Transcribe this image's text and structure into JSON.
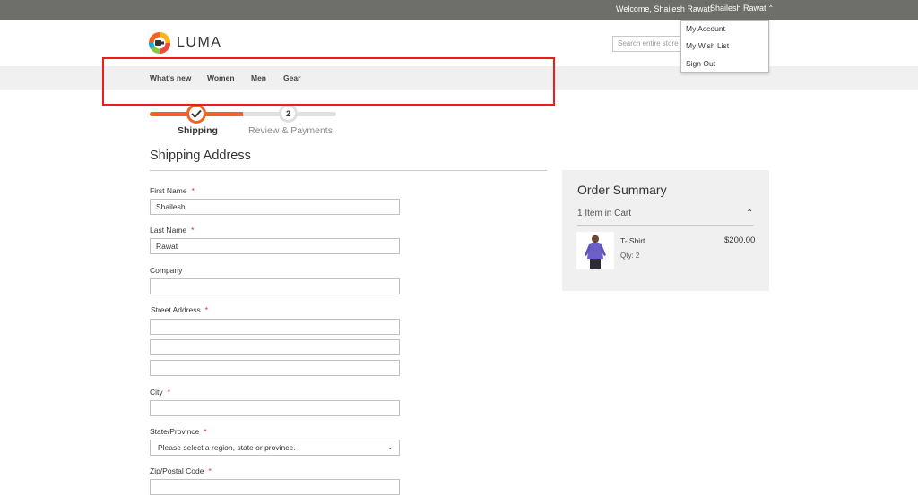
{
  "topbar": {
    "welcome": "Welcome, Shailesh Rawat!",
    "user_name": "Shailesh Rawat",
    "chevron": "up-chevron-icon"
  },
  "account_menu": {
    "items": [
      "My Account",
      "My Wish List",
      "Sign Out"
    ]
  },
  "header": {
    "logo_text": "LUMA",
    "search_placeholder": "Search entire store here..."
  },
  "nav": {
    "items": [
      "What's new",
      "Women",
      "Men",
      "Gear"
    ]
  },
  "progress": {
    "steps": [
      {
        "number": "",
        "label": "Shipping",
        "state": "complete"
      },
      {
        "number": "2",
        "label": "Review & Payments",
        "state": "pending"
      }
    ]
  },
  "shipping": {
    "title": "Shipping Address",
    "fields": {
      "first_name": {
        "label": "First Name",
        "value": "Shailesh",
        "required": "*"
      },
      "last_name": {
        "label": "Last Name",
        "value": "Rawat",
        "required": "*"
      },
      "company": {
        "label": "Company",
        "value": ""
      },
      "street": {
        "label": "Street Address",
        "required": "*",
        "lines": [
          "",
          "",
          ""
        ]
      },
      "city": {
        "label": "City",
        "value": "",
        "required": "*"
      },
      "state": {
        "label": "State/Province",
        "value": "Please select a region, state or province.",
        "required": "*"
      },
      "zip": {
        "label": "Zip/Postal Code",
        "value": "",
        "required": "*"
      }
    }
  },
  "summary": {
    "title": "Order Summary",
    "count_text": "1 Item in Cart",
    "items": [
      {
        "name": "T- Shirt",
        "qty": "Qty: 2",
        "price": "$200.00"
      }
    ]
  },
  "colors": {
    "accent": "#f26322",
    "highlight_box": "#ee1c1c",
    "topbar": "#6e6e6b",
    "navbar": "#f0f0f0"
  }
}
